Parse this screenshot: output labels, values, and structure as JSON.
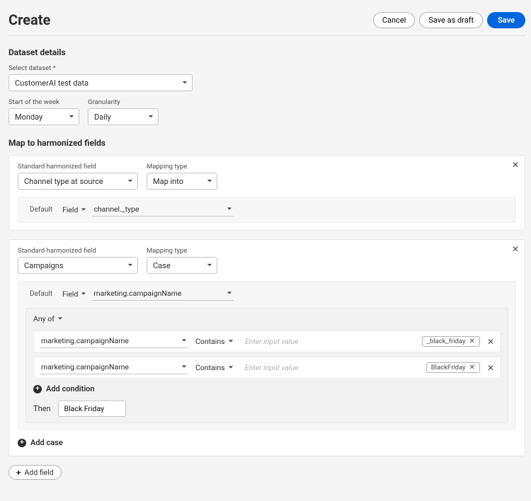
{
  "header": {
    "title": "Create",
    "cancel": "Cancel",
    "save_draft": "Save as draft",
    "save": "Save"
  },
  "dataset": {
    "section_title": "Dataset details",
    "select_label": "Select dataset",
    "select_value": "CustomerAI test data",
    "start_label": "Start of the week",
    "start_value": "Monday",
    "gran_label": "Granularity",
    "gran_value": "Daily"
  },
  "mapping": {
    "section_title": "Map to harmonized fields",
    "labels": {
      "std_field": "Standard harmonized field",
      "map_type": "Mapping type",
      "default": "Default",
      "field": "Field",
      "any_of": "Any of",
      "then": "Then",
      "add_condition": "Add condition",
      "add_case": "Add case",
      "add_field": "Add field",
      "input_placeholder": "Enter input value"
    },
    "cards": [
      {
        "std_value": "Channel type at source",
        "map_value": "Map into",
        "default_field_value": "channel._type"
      },
      {
        "std_value": "Campaigns",
        "map_value": "Case",
        "default_field_value": "marketing.campaignName",
        "conditions": [
          {
            "field": "marketing.campaignName",
            "op": "Contains",
            "tag": "_black_friday"
          },
          {
            "field": "marketing.campaignName",
            "op": "Contains",
            "tag": "BlackFriday"
          }
        ],
        "then_value": "Black Friday"
      }
    ]
  }
}
